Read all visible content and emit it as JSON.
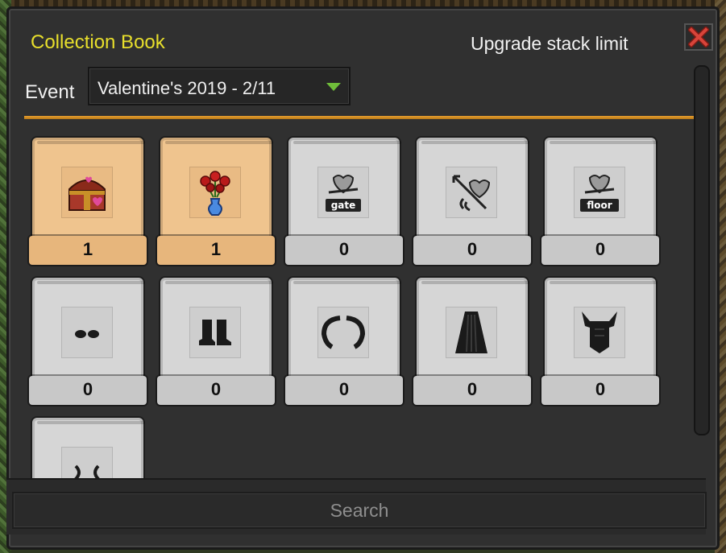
{
  "window": {
    "title": "Collection Book",
    "upgrade_label": "Upgrade stack limit"
  },
  "event": {
    "label": "Event",
    "selected": "Valentine's 2019 - 2/11"
  },
  "items": [
    {
      "icon": "treasure-chest-icon",
      "count": "1",
      "collected": true
    },
    {
      "icon": "rose-vase-icon",
      "count": "1",
      "collected": true
    },
    {
      "icon": "heart-gate-icon",
      "count": "0",
      "collected": false,
      "caption": "gate"
    },
    {
      "icon": "heart-arrow-icon",
      "count": "0",
      "collected": false
    },
    {
      "icon": "heart-floor-icon",
      "count": "0",
      "collected": false,
      "caption": "floor"
    },
    {
      "icon": "shoes-icon",
      "count": "0",
      "collected": false
    },
    {
      "icon": "boots-icon",
      "count": "0",
      "collected": false
    },
    {
      "icon": "horns-icon",
      "count": "0",
      "collected": false
    },
    {
      "icon": "cape-icon",
      "count": "0",
      "collected": false
    },
    {
      "icon": "armor-icon",
      "count": "0",
      "collected": false
    },
    {
      "icon": "antennae-icon",
      "count": "",
      "collected": false
    }
  ],
  "search": {
    "placeholder": "Search"
  },
  "colors": {
    "title": "#e8df2c",
    "divider": "#e8a030",
    "select_arrow": "#6fbd3a",
    "close": "#d8443a"
  }
}
